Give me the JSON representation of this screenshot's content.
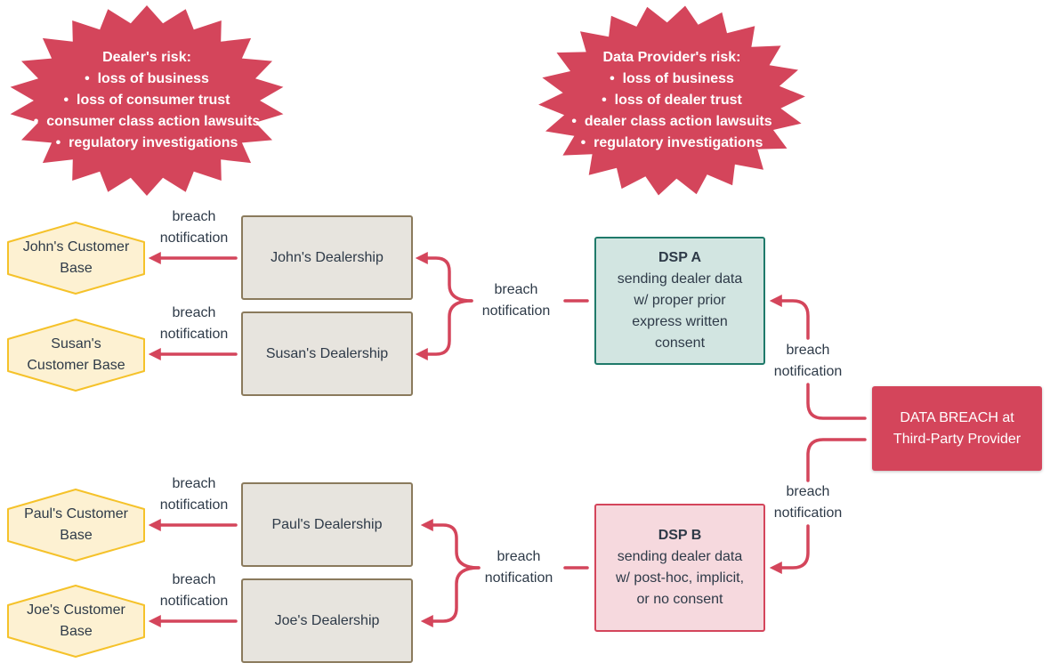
{
  "colors": {
    "accent_red": "#d4455b",
    "dsp_a_fill": "#d2e5e1",
    "dsp_a_border": "#1f7a6a",
    "dsp_b_fill": "#f6d9de",
    "dealer_fill": "#e7e4de",
    "customer_fill": "#fdf1d2",
    "customer_border": "#f5c22a"
  },
  "risks": [
    {
      "title": "Dealer's risk:",
      "items": [
        "loss of business",
        "loss of consumer trust",
        "consumer class action lawsuits",
        "regulatory investigations"
      ]
    },
    {
      "title": "Data Provider's risk:",
      "items": [
        "loss of business",
        "loss of dealer trust",
        "dealer class action lawsuits",
        "regulatory investigations"
      ]
    }
  ],
  "customers": [
    "John's Customer Base",
    "Susan's Customer Base",
    "Paul's Customer Base",
    "Joe's Customer Base"
  ],
  "dealerships": [
    "John's Dealership",
    "Susan's Dealership",
    "Paul's Dealership",
    "Joe's Dealership"
  ],
  "dsp_a": {
    "title": "DSP A",
    "lines": [
      "sending dealer data",
      "w/ proper prior",
      "express written",
      "consent"
    ]
  },
  "dsp_b": {
    "title": "DSP B",
    "lines": [
      "sending dealer data",
      "w/ post-hoc, implicit,",
      "or no consent"
    ]
  },
  "breach": {
    "lines": [
      "DATA BREACH at",
      "Third-Party Provider"
    ]
  },
  "edge_label": [
    "breach",
    "notification"
  ]
}
